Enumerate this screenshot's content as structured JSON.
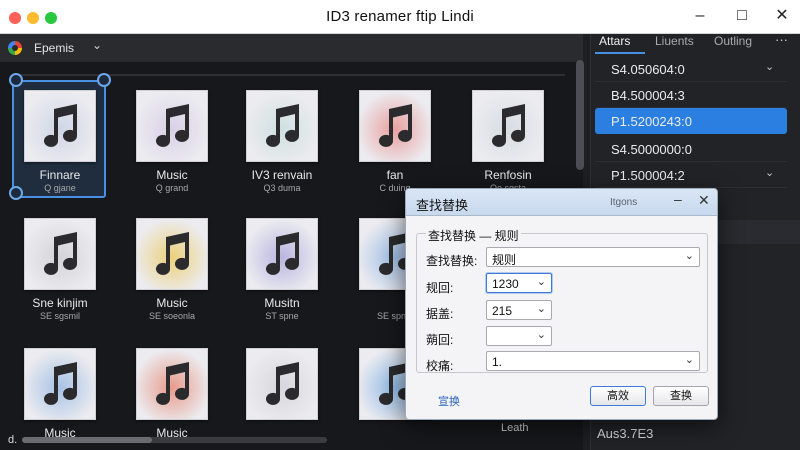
{
  "window": {
    "title": "ID3 renamer ftip Lindi"
  },
  "toolbar": {
    "label": "Epemis"
  },
  "tiles": [
    {
      "title": "Finnare",
      "sub": "Q gjane",
      "tint": "#cfd6e6"
    },
    {
      "title": "Music",
      "sub": "Q grand",
      "tint": "#d9d0e6"
    },
    {
      "title": "IV3 renvain",
      "sub": "Q3 duma",
      "tint": "#cfe0e0"
    },
    {
      "title": "fan",
      "sub": "C duing",
      "tint": "#e9a0a0"
    },
    {
      "title": "Renfosin",
      "sub": "Oe sgsta",
      "tint": "#d6dde3"
    },
    {
      "title": "Sne kinjim",
      "sub": "SE sgsmil",
      "tint": "#d3d3d8"
    },
    {
      "title": "Music",
      "sub": "SE soeonla",
      "tint": "#ecd07a"
    },
    {
      "title": "Musitn",
      "sub": "ST spne",
      "tint": "#b9b5e0"
    },
    {
      "title": "",
      "sub": "SE spnia",
      "tint": "#9fbde6"
    },
    {
      "title": "",
      "sub": "",
      "tint": "#cfd7e4"
    },
    {
      "title": "Music",
      "sub": "",
      "tint": "#a7c2e6"
    },
    {
      "title": "Music",
      "sub": "",
      "tint": "#e89a8a"
    },
    {
      "title": "",
      "sub": "",
      "tint": "#d6d6dc"
    },
    {
      "title": "",
      "sub": "",
      "tint": "#8fb9e6"
    }
  ],
  "right_panel": {
    "tabs": [
      "Attars",
      "Liuents",
      "Outling"
    ],
    "more": "···",
    "items": [
      "S4.050604:0",
      "B4.500004:3",
      "P1.5200243:0",
      "S4.5000000:0",
      "P1.500004:2"
    ],
    "bottom_text": "Aus3.7E3",
    "bottom_left_text": "Leath"
  },
  "dialog": {
    "title": "查找替换",
    "under_title": "Itgons",
    "group_label": "查找替换 — 规则",
    "field1_label": "查找替换:",
    "field1_value": "规则",
    "field2_label": "规回:",
    "field2_value": "1230",
    "field3_label": "据盖:",
    "field3_value": "215",
    "field4_label": "蒴回:",
    "field4_value": "",
    "field5_label": "校痛:",
    "field5_value": "1.",
    "link": "宣换",
    "btn_apply": "高效",
    "btn_replace": "查换"
  },
  "footer": {
    "corner": "d."
  }
}
